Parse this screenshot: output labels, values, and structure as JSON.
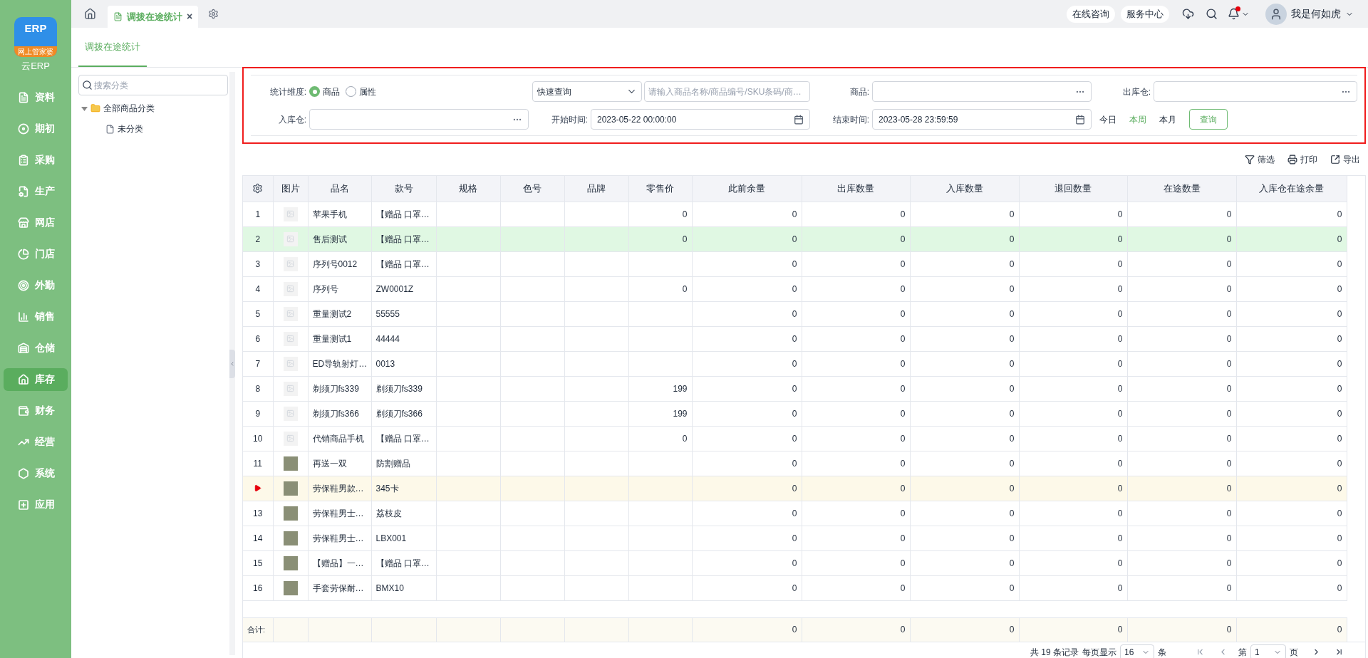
{
  "sidebar": {
    "logo": {
      "mark": "ERP",
      "banner": "网上管家婆"
    },
    "app_name": "云ERP",
    "items": [
      {
        "label": "资料",
        "selected": false
      },
      {
        "label": "期初",
        "selected": false
      },
      {
        "label": "采购",
        "selected": false
      },
      {
        "label": "生产",
        "selected": false
      },
      {
        "label": "网店",
        "selected": false
      },
      {
        "label": "门店",
        "selected": false
      },
      {
        "label": "外勤",
        "selected": false
      },
      {
        "label": "销售",
        "selected": false
      },
      {
        "label": "仓储",
        "selected": false
      },
      {
        "label": "库存",
        "selected": true
      },
      {
        "label": "财务",
        "selected": false
      },
      {
        "label": "经营",
        "selected": false
      },
      {
        "label": "系统",
        "selected": false
      },
      {
        "label": "应用",
        "selected": false
      }
    ]
  },
  "topbar": {
    "tabs": [
      {
        "label": "调拨在途统计",
        "close": "×",
        "selected": true
      }
    ],
    "links": [
      "在线咨询",
      "服务中心"
    ],
    "notification_dot": true,
    "user": "我是何如虎"
  },
  "page_tab": {
    "label": "调拨在途统计",
    "selected": true
  },
  "category_panel": {
    "search_placeholder": "搜索分类",
    "tree": [
      {
        "label": "全部商品分类",
        "expanded": true,
        "children": [
          {
            "label": "未分类"
          }
        ]
      }
    ]
  },
  "filters": {
    "dimension": {
      "label": "统计维度:",
      "options": [
        {
          "label": "商品",
          "selected": true
        },
        {
          "label": "属性",
          "selected": false
        }
      ]
    },
    "quick_query": {
      "value": "快速查询",
      "placeholder": "请输入商品名称/商品编号/SKU条码/商…"
    },
    "product": {
      "label": "商品:"
    },
    "out_warehouse": {
      "label": "出库仓:"
    },
    "in_warehouse": {
      "label": "入库仓:"
    },
    "start_time": {
      "label": "开始时间:",
      "value": "2023-05-22 00:00:00"
    },
    "end_time": {
      "label": "结束时间:",
      "value": "2023-05-28 23:59:59"
    },
    "shortcuts": [
      {
        "label": "今日",
        "selected": false
      },
      {
        "label": "本周",
        "selected": true
      },
      {
        "label": "本月",
        "selected": false
      }
    ],
    "query_button": "查询"
  },
  "toolbar": [
    {
      "kind": "filter",
      "label": "筛选"
    },
    {
      "kind": "print",
      "label": "打印"
    },
    {
      "kind": "export",
      "label": "导出"
    }
  ],
  "table": {
    "columns": [
      "图片",
      "品名",
      "款号",
      "规格",
      "色号",
      "品牌",
      "零售价",
      "此前余量",
      "出库数量",
      "入库数量",
      "退回数量",
      "在途数量",
      "入库仓在途余量"
    ],
    "rows": [
      {
        "no": "1",
        "kind": "placeholder",
        "name": "苹果手机",
        "code": "【赠品 口罩…",
        "price": "0",
        "values": [
          "0",
          "0",
          "0",
          "0",
          "0",
          "0"
        ],
        "selected": false,
        "current": false
      },
      {
        "no": "2",
        "kind": "placeholder",
        "name": "售后测试",
        "code": "【赠品 口罩…",
        "price": "0",
        "values": [
          "0",
          "0",
          "0",
          "0",
          "0",
          "0"
        ],
        "selected": true,
        "current": false
      },
      {
        "no": "3",
        "kind": "placeholder",
        "name": "序列号0012",
        "code": "【赠品 口罩…",
        "values": [
          "0",
          "0",
          "0",
          "0",
          "0",
          "0"
        ],
        "selected": false,
        "current": false
      },
      {
        "no": "4",
        "kind": "placeholder",
        "name": "序列号",
        "code": "ZW0001Z",
        "price": "0",
        "values": [
          "0",
          "0",
          "0",
          "0",
          "0",
          "0"
        ],
        "selected": false,
        "current": false
      },
      {
        "no": "5",
        "kind": "placeholder",
        "name": "重量测试2",
        "code": "55555",
        "values": [
          "0",
          "0",
          "0",
          "0",
          "0",
          "0"
        ],
        "selected": false,
        "current": false
      },
      {
        "no": "6",
        "kind": "placeholder",
        "name": "重量测试1",
        "code": "44444",
        "values": [
          "0",
          "0",
          "0",
          "0",
          "0",
          "0"
        ],
        "selected": false,
        "current": false
      },
      {
        "no": "7",
        "kind": "placeholder",
        "name": "ED导轨射灯…",
        "code": "0013",
        "values": [
          "0",
          "0",
          "0",
          "0",
          "0",
          "0"
        ],
        "selected": false,
        "current": false
      },
      {
        "no": "8",
        "kind": "placeholder",
        "name": "剃须刀fs339",
        "code": "剃须刀fs339",
        "price": "199",
        "values": [
          "0",
          "0",
          "0",
          "0",
          "0",
          "0"
        ],
        "selected": false,
        "current": false
      },
      {
        "no": "9",
        "kind": "placeholder",
        "name": "剃须刀fs366",
        "code": "剃须刀fs366",
        "price": "199",
        "values": [
          "0",
          "0",
          "0",
          "0",
          "0",
          "0"
        ],
        "selected": false,
        "current": false
      },
      {
        "no": "10",
        "kind": "placeholder",
        "name": "代销商品手机",
        "code": "【赠品 口罩…",
        "price": "0",
        "values": [
          "0",
          "0",
          "0",
          "0",
          "0",
          "0"
        ],
        "selected": false,
        "current": false
      },
      {
        "no": "11",
        "kind": "photo",
        "name": "再送一双",
        "code": "防割赠品",
        "values": [
          "0",
          "0",
          "0",
          "0",
          "0",
          "0"
        ],
        "selected": false,
        "current": false
      },
      {
        "kind": "photo",
        "name": "劳保鞋男款…",
        "code": "345卡",
        "values": [
          "0",
          "0",
          "0",
          "0",
          "0",
          "0"
        ],
        "selected": false,
        "current": true
      },
      {
        "no": "13",
        "kind": "photo",
        "name": "劳保鞋男士…",
        "code": "荔枝皮",
        "values": [
          "0",
          "0",
          "0",
          "0",
          "0",
          "0"
        ],
        "selected": false,
        "current": false
      },
      {
        "no": "14",
        "kind": "photo",
        "name": "劳保鞋男士…",
        "code": "LBX001",
        "values": [
          "0",
          "0",
          "0",
          "0",
          "0",
          "0"
        ],
        "selected": false,
        "current": false
      },
      {
        "no": "15",
        "kind": "photo",
        "name": "【赠品】一…",
        "code": "【赠品 口罩…",
        "values": [
          "0",
          "0",
          "0",
          "0",
          "0",
          "0"
        ],
        "selected": false,
        "current": false
      },
      {
        "no": "16",
        "kind": "photo",
        "name": "手套劳保耐…",
        "code": "BMX10",
        "values": [
          "0",
          "0",
          "0",
          "0",
          "0",
          "0"
        ],
        "selected": false,
        "current": false
      }
    ],
    "totals": {
      "label": "合计:",
      "values": [
        "0",
        "0",
        "0",
        "0",
        "0",
        "0"
      ]
    }
  },
  "pagination": {
    "summary": "共 19 条记录",
    "per_page_label": "每页显示",
    "per_page": "16",
    "per_page_unit": "条",
    "page_prefix": "第",
    "page": "1",
    "page_suffix": "页"
  }
}
